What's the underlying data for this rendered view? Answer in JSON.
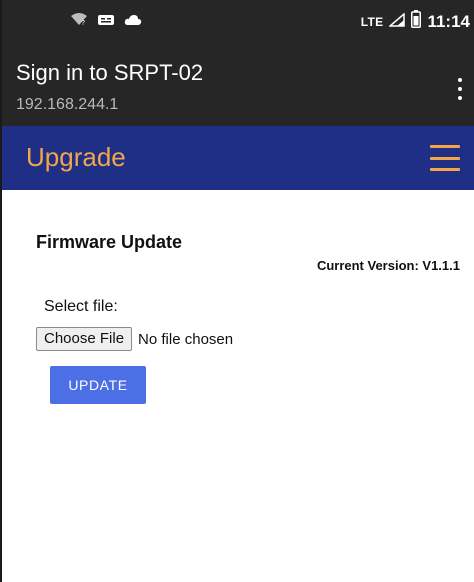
{
  "status_bar": {
    "network_label": "LTE",
    "time": "11:14",
    "icons": [
      "wifi-question-icon",
      "message-icon",
      "cloud-icon",
      "signal-icon",
      "battery-icon"
    ]
  },
  "browser": {
    "title": "Sign in to SRPT-02",
    "url": "192.168.244.1",
    "menu_icon": "more-vert-icon"
  },
  "app_header": {
    "title": "Upgrade",
    "menu_icon": "hamburger-menu-icon",
    "background_color": "#1f2f86",
    "accent_color": "#f2a64b"
  },
  "firmware": {
    "section_title": "Firmware Update",
    "current_version": "Current Version: V1.1.1",
    "select_label": "Select file:",
    "choose_file_label": "Choose File",
    "no_file_text": "No file chosen",
    "update_label": "UPDATE",
    "update_button_color": "#4d6fe6"
  }
}
